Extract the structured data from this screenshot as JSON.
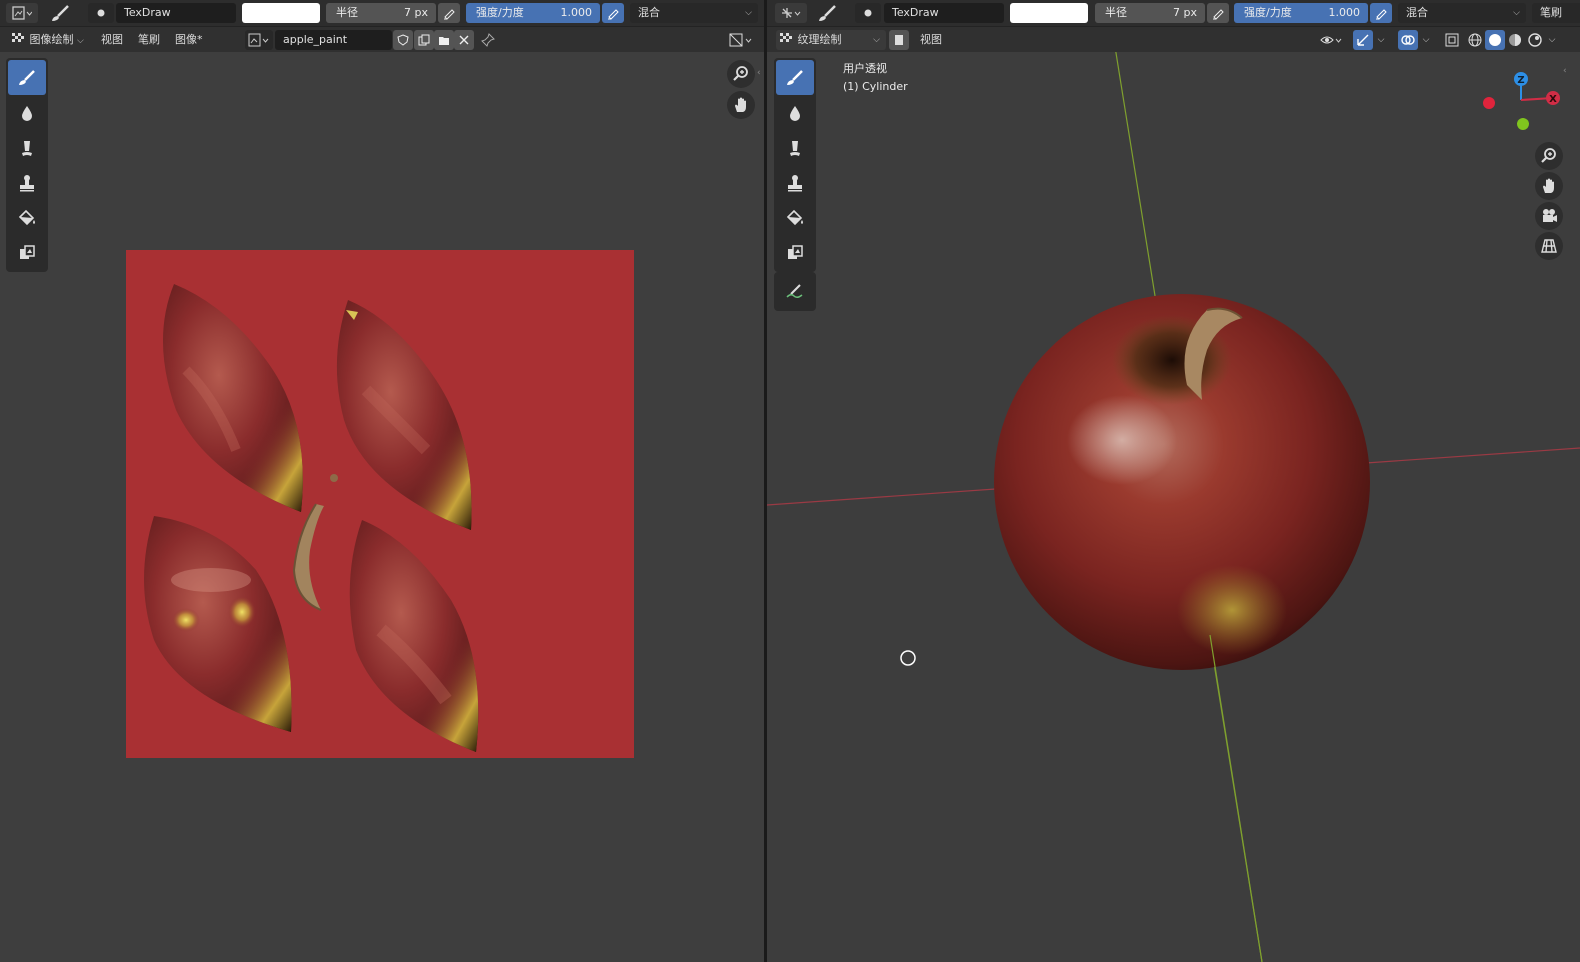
{
  "left": {
    "brush_name": "TexDraw",
    "radius_label": "半径",
    "radius_value": "7 px",
    "strength_label": "强度/力度",
    "strength_value": "1.000",
    "blend_value": "混合",
    "mode_label": "图像绘制",
    "menu_view": "视图",
    "menu_brush": "笔刷",
    "menu_image": "图像*",
    "image_name": "apple_paint",
    "canvas_bg": "#a93033"
  },
  "right": {
    "brush_name": "TexDraw",
    "radius_label": "半径",
    "radius_value": "7 px",
    "strength_label": "强度/力度",
    "strength_value": "1.000",
    "blend_value": "混合",
    "brush_menu_cut": "笔刷",
    "mode_label": "纹理绘制",
    "menu_view": "视图",
    "viewport_title": "用户透视",
    "viewport_object": "(1) Cylinder",
    "gizmo_z": "Z",
    "gizmo_x": "X"
  },
  "icons": [
    "editor-type-icon",
    "paint-brush-icon",
    "brush-preview-icon",
    "pen-pressure-icon",
    "mode-grid-icon",
    "image-browse-icon",
    "new-image-icon",
    "open-image-icon",
    "close-icon",
    "pin-icon",
    "draw-tool-icon",
    "soften-tool-icon",
    "smear-tool-icon",
    "clone-tool-icon",
    "fill-tool-icon",
    "mask-tool-icon",
    "annotate-tool-icon",
    "zoom-icon",
    "hand-icon",
    "camera-icon",
    "grid-icon",
    "eye-icon",
    "gizmo-icon",
    "overlay-icon",
    "xray-icon",
    "wireframe-icon",
    "solid-icon",
    "material-icon",
    "rendered-icon"
  ],
  "colors": {
    "accent": "#4772b3",
    "x_axis": "#d12d46",
    "y_axis": "#8bc62d",
    "z_axis": "#2d8fe6"
  }
}
